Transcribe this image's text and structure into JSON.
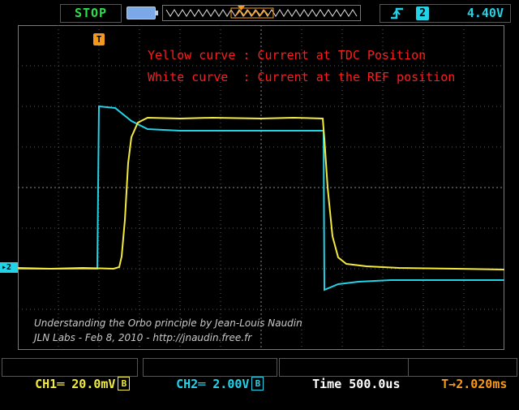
{
  "top_bar": {
    "run_state": "STOP",
    "trigger_source": "2",
    "trigger_level": "4.40V"
  },
  "screen": {
    "annotations": [
      "Yellow curve : Current at TDC Position",
      "White curve  : Current at the REF position"
    ],
    "credit_lines": [
      "Understanding the Orbo principle by Jean-Louis Naudin",
      "JLN Labs - Feb 8, 2010 - http://jnaudin.free.fr"
    ],
    "trigger_marker": "T",
    "ch_marker": "2"
  },
  "bottom_bar": {
    "ch1": "CH1",
    "ch1_scale": "20.0mV",
    "ch2": "CH2",
    "ch2_scale": "2.00V",
    "time_label": "Time",
    "time_value": "500.0us",
    "trigger_offset": "2.020ms",
    "bw_badge": "B"
  },
  "colors": {
    "ch1": "#f2ea3c",
    "ch2": "#22d3e8",
    "trigger": "#f39a1e",
    "annotation": "#ff1c1c"
  },
  "icons": {
    "run_state": "stop",
    "battery": "battery-icon",
    "trigger_edge": "rising-edge-icon"
  }
}
